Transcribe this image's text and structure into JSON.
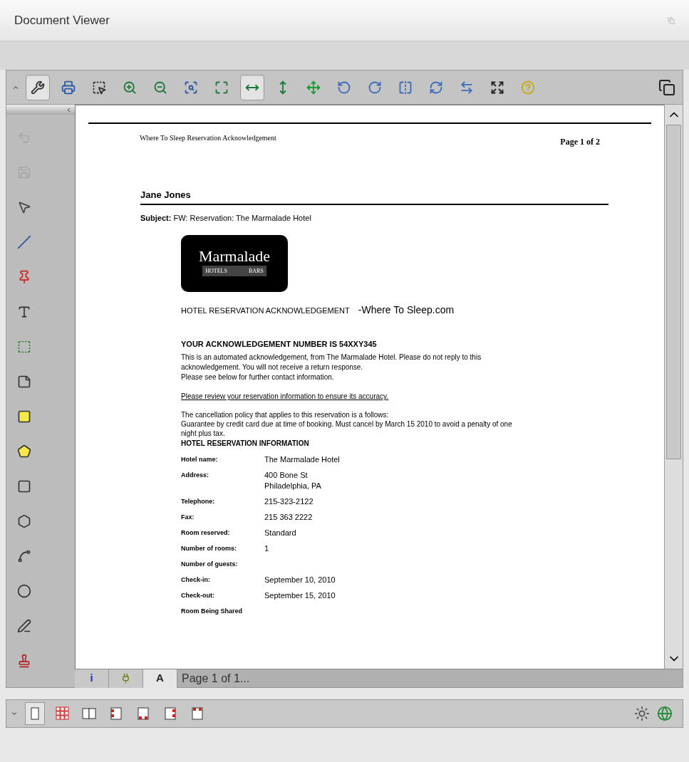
{
  "window": {
    "title": "Document Viewer"
  },
  "toolbar": [
    {
      "kind": "tools",
      "selected": true
    },
    {
      "kind": "print",
      "selected": false
    },
    {
      "kind": "select-zoom",
      "selected": false
    },
    {
      "kind": "zoom-in",
      "selected": false
    },
    {
      "kind": "zoom-out",
      "selected": false
    },
    {
      "kind": "zoom-rect",
      "selected": false
    },
    {
      "kind": "fit-page",
      "selected": false
    },
    {
      "kind": "fit-width",
      "selected": true
    },
    {
      "kind": "fit-height",
      "selected": false
    },
    {
      "kind": "pan",
      "selected": false
    },
    {
      "kind": "rotate-left",
      "selected": false
    },
    {
      "kind": "rotate-right",
      "selected": false
    },
    {
      "kind": "flip",
      "selected": false
    },
    {
      "kind": "rotate-page",
      "selected": false
    },
    {
      "kind": "swap",
      "selected": false
    },
    {
      "kind": "fullscreen",
      "selected": false
    },
    {
      "kind": "help",
      "selected": false
    }
  ],
  "tools": [
    {
      "kind": "undo",
      "disabled": true
    },
    {
      "kind": "save",
      "disabled": true
    },
    {
      "kind": "pointer",
      "disabled": false
    },
    {
      "kind": "line",
      "disabled": false
    },
    {
      "kind": "pin",
      "disabled": false
    },
    {
      "kind": "text",
      "disabled": false
    },
    {
      "kind": "textbox",
      "disabled": false
    },
    {
      "kind": "note",
      "disabled": false
    },
    {
      "kind": "highlight-rect",
      "disabled": false
    },
    {
      "kind": "highlight-poly",
      "disabled": false
    },
    {
      "kind": "rect",
      "disabled": false
    },
    {
      "kind": "polygon",
      "disabled": false
    },
    {
      "kind": "freeform",
      "disabled": false
    },
    {
      "kind": "ellipse",
      "disabled": false
    },
    {
      "kind": "pen",
      "disabled": false
    },
    {
      "kind": "stamp",
      "disabled": false
    }
  ],
  "document": {
    "running_head": "Where To Sleep Reservation Acknowledgement",
    "page_number": "Page 1 of 2",
    "sender": "Jane Jones",
    "subject": "**Subject:** FW: Reservation: The Marmalade Hotel",
    "logo": {
      "name": "Marmalade",
      "tagline_start": "HOTELS",
      "tagline_end": "BARS"
    },
    "heading": "HOTEL RESERVATION ACKNOWLEDGEMENT",
    "site": "-Where To Sleep.com",
    "ack_number": "YOUR ACKNOWLEDGEMENT NUMBER IS 54XXY345",
    "intro": [
      "This is an automated acknowledgement, from The Marmalade Hotel. Please do not reply to this acknowledgement. You will not receive a return response.",
      "Please see below for further contact information."
    ],
    "review_link": "Please review your reservation information to ensure its accuracy.",
    "policy": [
      "The cancellation policy that applies to this reservation is a follows:",
      "Guarantee by credit card due at time of booking. Must cancel by March 15 2010 to avoid a penalty of one night plus tax."
    ],
    "info_heading": "HOTEL RESERVATION INFORMATION",
    "fields": [
      {
        "label": "Hotel name:",
        "value": [
          "The Marmalade Hotel"
        ]
      },
      {
        "label": "Address:",
        "value": [
          "400 Bone St",
          "Philadelphia, PA"
        ]
      },
      {
        "label": "Telephone:",
        "value": [
          "215-323-2122"
        ]
      },
      {
        "label": "Fax:",
        "value": [
          "215 363 2222"
        ]
      },
      {
        "label": "Room reserved:",
        "value": [
          "Standard"
        ]
      },
      {
        "label": "Number of rooms:",
        "value": [
          "1"
        ]
      },
      {
        "label": "Number of guests:"
      },
      {
        "label": "Check-in:",
        "value": [
          "September 10, 2010"
        ]
      },
      {
        "label": "Check-out:",
        "value": [
          "September 15, 2010"
        ]
      },
      {
        "label": "Room Being Shared"
      }
    ]
  },
  "bottom_tabs": [
    {
      "kind": "info",
      "label": "i",
      "selected": false
    },
    {
      "kind": "plugin",
      "selected": false
    },
    {
      "kind": "text",
      "label": "A",
      "selected": true
    }
  ],
  "page_status": "Page 1 of 1...",
  "layouts": [
    {
      "kind": "single",
      "selected": true
    },
    {
      "kind": "grid",
      "selected": false
    },
    {
      "kind": "two-page",
      "selected": false
    },
    {
      "kind": "strip-left",
      "selected": false
    },
    {
      "kind": "strip-bottom",
      "selected": false
    },
    {
      "kind": "strip-right",
      "selected": false
    },
    {
      "kind": "strip-top",
      "selected": false
    }
  ],
  "status_icons": [
    {
      "kind": "brightness"
    },
    {
      "kind": "globe"
    }
  ]
}
